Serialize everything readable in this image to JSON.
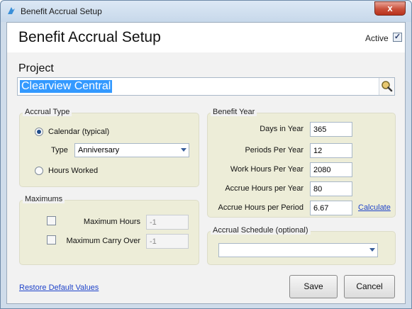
{
  "window": {
    "title": "Benefit Accrual Setup",
    "close_glyph": "x"
  },
  "header": {
    "title": "Benefit Accrual Setup",
    "active_label": "Active",
    "active_checked": true
  },
  "project": {
    "label": "Project",
    "value": "Clearview Central",
    "search_icon": "search-icon"
  },
  "accrual_type": {
    "legend": "Accrual Type",
    "calendar_label": "Calendar (typical)",
    "calendar_selected": true,
    "type_label": "Type",
    "type_value": "Anniversary",
    "hours_worked_label": "Hours Worked",
    "hours_worked_selected": false
  },
  "maximums": {
    "legend": "Maximums",
    "max_hours_label": "Maximum Hours",
    "max_hours_value": "-1",
    "max_hours_checked": false,
    "max_carry_label": "Maximum Carry Over",
    "max_carry_value": "-1",
    "max_carry_checked": false
  },
  "benefit_year": {
    "legend": "Benefit Year",
    "days_label": "Days in Year",
    "days_value": "365",
    "periods_label": "Periods Per Year",
    "periods_value": "12",
    "work_hours_label": "Work Hours Per Year",
    "work_hours_value": "2080",
    "accrue_year_label": "Accrue Hours per Year",
    "accrue_year_value": "80",
    "accrue_period_label": "Accrue Hours per Period",
    "accrue_period_value": "6.67",
    "calculate_link": "Calculate"
  },
  "accrual_schedule": {
    "legend": "Accrual Schedule (optional)",
    "value": ""
  },
  "footer": {
    "restore_link": "Restore Default Values",
    "save_label": "Save",
    "cancel_label": "Cancel"
  }
}
